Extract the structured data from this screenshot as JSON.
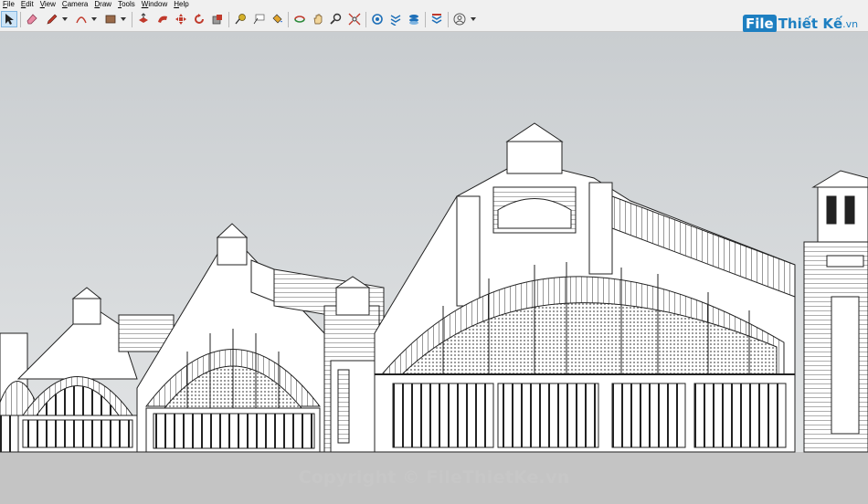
{
  "menu": {
    "items": [
      "File",
      "Edit",
      "View",
      "Camera",
      "Draw",
      "Tools",
      "Window",
      "Help"
    ]
  },
  "toolbar": {
    "tools": [
      "select-icon",
      "eraser-icon",
      "pencil-icon",
      "arc-icon",
      "rectangle-icon",
      "push-pull-icon",
      "follow-me-icon",
      "move-icon",
      "rotate-icon",
      "scale-icon",
      "tape-measure-icon",
      "text-icon",
      "paint-bucket-icon",
      "orbit-icon",
      "pan-icon",
      "zoom-icon",
      "zoom-extents-icon",
      "warehouse-icon",
      "extensions-icon",
      "model-info-icon",
      "layout-icon",
      "account-icon"
    ]
  },
  "logo": {
    "box": "File",
    "name": "Thiết Kế",
    "tld": ".vn"
  },
  "watermark": {
    "text": "Copyright © FileThietKe.vn"
  },
  "colors": {
    "sky_top": "#c9cdd0",
    "sky_bottom": "#e4e6e7",
    "ground": "#c4c4c4",
    "accent": "#1d7fc1"
  }
}
